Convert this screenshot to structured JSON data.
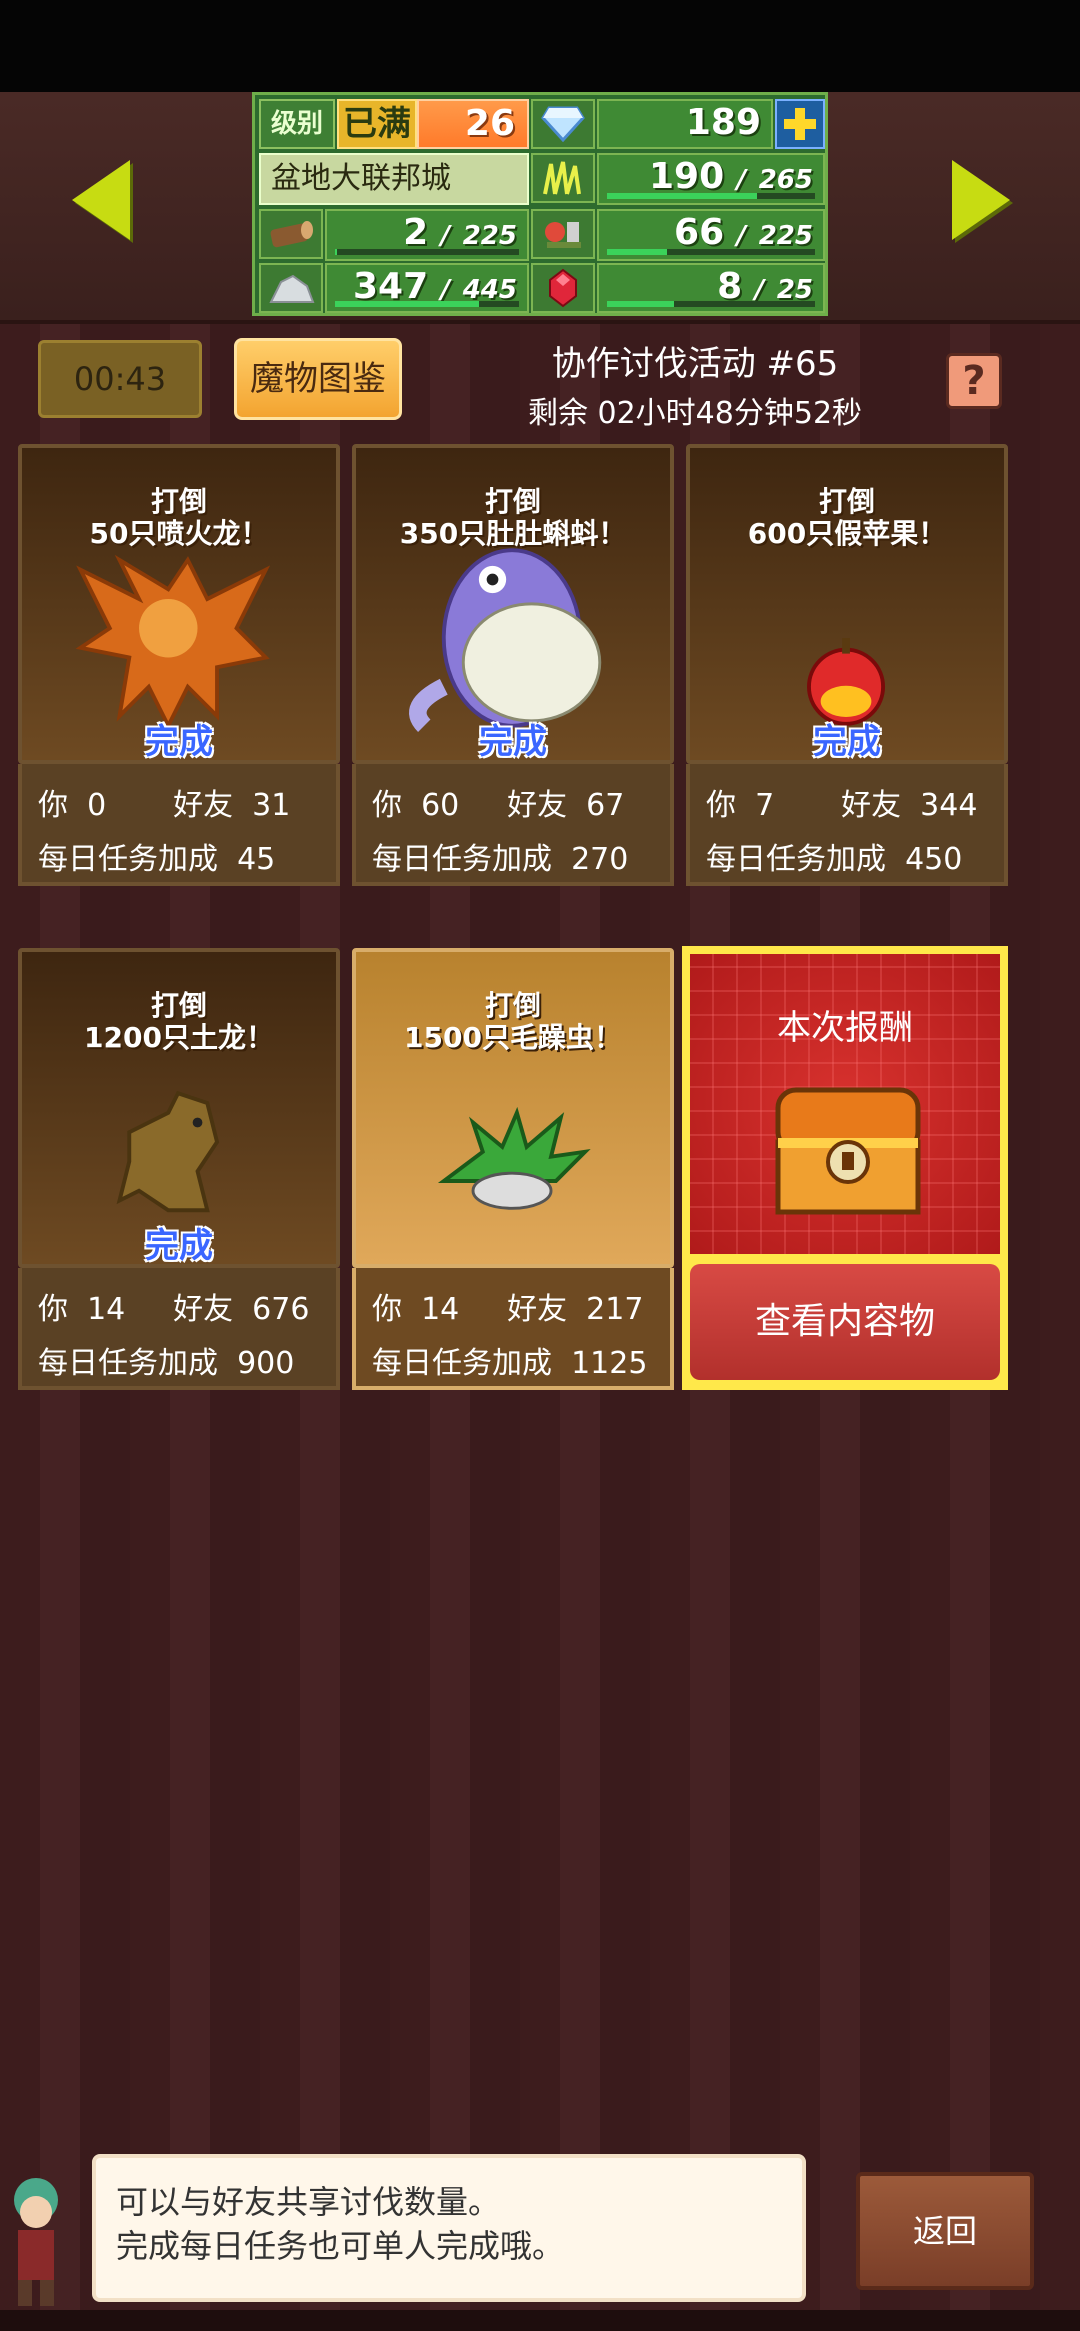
{
  "stats": {
    "level_label": "级别",
    "level_max": "已满",
    "level_value": "26",
    "gems": "189",
    "city_name": "盆地大联邦城",
    "grass_current": "190",
    "grass_max": "265",
    "grass_fill": 0.72,
    "wood_current": "2",
    "wood_max": "225",
    "wood_fill": 0.01,
    "food_current": "66",
    "food_max": "225",
    "food_fill": 0.29,
    "ore_current": "347",
    "ore_max": "445",
    "ore_fill": 0.78,
    "ruby_current": "8",
    "ruby_max": "25",
    "ruby_fill": 0.32,
    "separator": "/"
  },
  "timer": "00:43",
  "bestiary_label": "魔物图鉴",
  "event_title": "协作讨伐活动 #65",
  "event_remaining": "剩余 02小时48分钟52秒",
  "help_label": "?",
  "labels": {
    "you": "你",
    "friend": "好友",
    "daily": "每日任务加成",
    "done": "完成"
  },
  "cards": [
    {
      "title_1": "打倒",
      "title_2": "50只喷火龙！",
      "you": "0",
      "friend": "31",
      "daily": "45"
    },
    {
      "title_1": "打倒",
      "title_2": "350只肚肚蝌蚪！",
      "you": "60",
      "friend": "67",
      "daily": "270"
    },
    {
      "title_1": "打倒",
      "title_2": "600只假苹果！",
      "you": "7",
      "friend": "344",
      "daily": "450"
    },
    {
      "title_1": "打倒",
      "title_2": "1200只土龙！",
      "you": "14",
      "friend": "676",
      "daily": "900"
    },
    {
      "title_1": "打倒",
      "title_2": "1500只毛躁虫！",
      "you": "14",
      "friend": "217",
      "daily": "1125"
    }
  ],
  "reward": {
    "title": "本次报酬",
    "button": "查看内容物"
  },
  "dialog": {
    "line1": "可以与好友共享讨伐数量。",
    "line2": "完成每日任务也可单人完成哦。"
  },
  "back_label": "返回",
  "colors": {
    "accent_yellow": "#c7dc12",
    "done_blue": "#3a66ff",
    "reward_red": "#d8322e"
  }
}
